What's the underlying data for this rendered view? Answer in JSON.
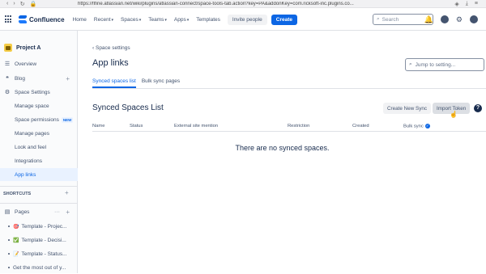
{
  "browser": {
    "url": "https://flfine.atlassian.net/wiki/plugins/atlassian-connect/space-tools-tab.action?key=PA&addonKey=com.ricksoft-inc.plugins.co..."
  },
  "topnav": {
    "logo": "Confluence",
    "items": [
      "Home",
      "Recent",
      "Spaces",
      "Teams",
      "Apps",
      "Templates"
    ],
    "invite": "Invite people",
    "create": "Create",
    "search_placeholder": "Search"
  },
  "sidebar": {
    "space_name": "Project A",
    "items": {
      "overview": "Overview",
      "blog": "Blog",
      "space_settings": "Space Settings",
      "manage_space": "Manage space",
      "space_permissions": "Space permissions",
      "new_badge": "NEW",
      "manage_pages": "Manage pages",
      "look_and_feel": "Look and feel",
      "integrations": "Integrations",
      "app_links": "App links"
    },
    "shortcuts_heading": "SHORTCUTS",
    "pages_label": "Pages",
    "pages": [
      {
        "emoji": "🎯",
        "label": "Template - Projec..."
      },
      {
        "emoji": "✅",
        "label": "Template - Decisi..."
      },
      {
        "emoji": "📝",
        "label": "Template - Status..."
      },
      {
        "emoji": "",
        "label": "Get the most out of y..."
      }
    ]
  },
  "main": {
    "breadcrumb": "Space settings",
    "title": "App links",
    "jump_placeholder": "Jump to setting...",
    "tabs": [
      "Synced spaces list",
      "Bulk sync pages"
    ],
    "section_title": "Synced Spaces List",
    "create_sync": "Create New Sync",
    "import_token": "Import Token",
    "columns": [
      "Name",
      "Status",
      "External site mention",
      "Restriction",
      "Created",
      "Bulk sync"
    ],
    "empty_message": "There are no synced spaces."
  }
}
